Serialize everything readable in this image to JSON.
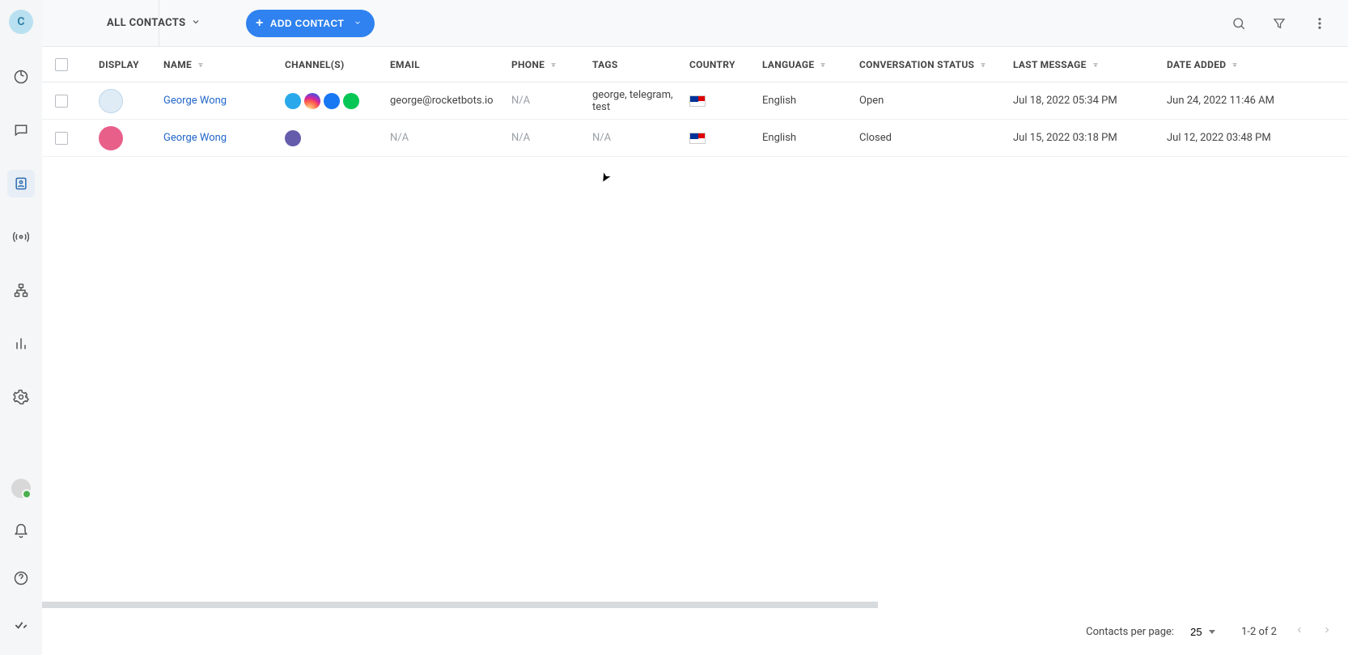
{
  "workspace_letter": "C",
  "topbar": {
    "segment_label": "ALL CONTACTS",
    "add_button": "ADD CONTACT"
  },
  "columns": {
    "display": "DISPLAY",
    "name": "NAME",
    "channels": "CHANNEL(S)",
    "email": "EMAIL",
    "phone": "PHONE",
    "tags": "TAGS",
    "country": "COUNTRY",
    "language": "LANGUAGE",
    "conv_status": "CONVERSATION STATUS",
    "last_msg": "LAST MESSAGE",
    "date_added": "DATE ADDED"
  },
  "rows": [
    {
      "name": "George Wong",
      "email": "george@rocketbots.io",
      "phone": "N/A",
      "tags": "george, telegram, test",
      "country": "MY",
      "language": "English",
      "status": "Open",
      "last_msg": "Jul 18, 2022 05:34 PM",
      "date_added": "Jun 24, 2022 11:46 AM",
      "avatar_variant": "alt1",
      "channels": [
        "tg",
        "ig",
        "fb",
        "ln"
      ]
    },
    {
      "name": "George Wong",
      "email": "N/A",
      "phone": "N/A",
      "tags": "N/A",
      "country": "MY",
      "language": "English",
      "status": "Closed",
      "last_msg": "Jul 15, 2022 03:18 PM",
      "date_added": "Jul 12, 2022 03:48 PM",
      "avatar_variant": "",
      "channels": [
        "vb"
      ]
    }
  ],
  "footer": {
    "per_page_label": "Contacts per page:",
    "per_page_value": "25",
    "range": "1-2 of 2"
  }
}
